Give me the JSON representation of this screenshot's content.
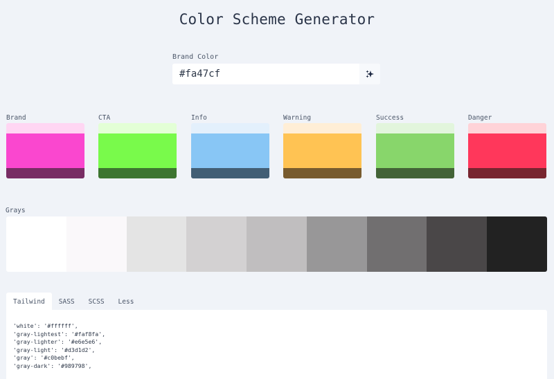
{
  "title": "Color Scheme Generator",
  "brand_input": {
    "label": "Brand Color",
    "value": "#fa47cf",
    "random_button_icon": "sparkle-icon"
  },
  "swatches": [
    {
      "label": "Brand",
      "light": "#ffd6f3",
      "base": "#fa47cf",
      "dark": "#782c64"
    },
    {
      "label": "CTA",
      "light": "#e3ffd6",
      "base": "#79fa4b",
      "dark": "#3d7530"
    },
    {
      "label": "Info",
      "light": "#e3f0fc",
      "base": "#88c6f5",
      "dark": "#425e75"
    },
    {
      "label": "Warning",
      "light": "#ffeed6",
      "base": "#ffc353",
      "dark": "#785b2e"
    },
    {
      "label": "Success",
      "light": "#e2f5dc",
      "base": "#88d66b",
      "dark": "#436337"
    },
    {
      "label": "Danger",
      "light": "#ffd3d8",
      "base": "#ff375b",
      "dark": "#78252f"
    }
  ],
  "grays": {
    "label": "Grays",
    "colors": [
      "#ffffff",
      "#faf8fa",
      "#e4e4e4",
      "#d3d1d2",
      "#c0bebf",
      "#989798",
      "#716f70",
      "#4a4748",
      "#222222"
    ]
  },
  "tabs": [
    {
      "label": "Tailwind",
      "active": true
    },
    {
      "label": "SASS",
      "active": false
    },
    {
      "label": "SCSS",
      "active": false
    },
    {
      "label": "Less",
      "active": false
    }
  ],
  "code": "'white': '#ffffff',\n'gray-lightest': '#faf8fa',\n'gray-lighter': '#e6e5e6',\n'gray-light': '#d3d1d2',\n'gray': '#c0bebf',\n'gray-dark': '#989798',"
}
